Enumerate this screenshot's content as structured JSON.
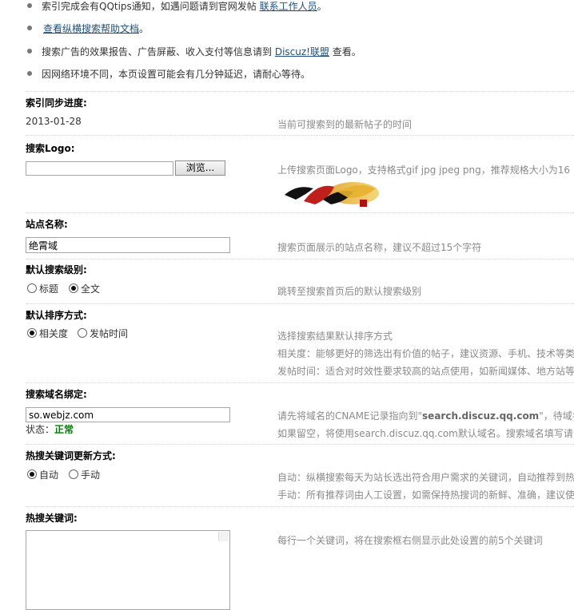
{
  "tips": {
    "item1": {
      "text": "索引完成会有QQtips通知，如遇问题请到官网发帖 ",
      "link": "联系工作人员",
      "after": "。"
    },
    "item2": {
      "link": "查看纵横搜索帮助文档",
      "after": "。"
    },
    "item3": {
      "text": "搜索广告的效果报告、广告屏蔽、收入支付等信息请到 ",
      "link": "Discuz!联盟",
      "after": " 查看。"
    },
    "item4": {
      "text": "因网络环境不同，本页设置可能会有几分钟延迟，请耐心等待。"
    }
  },
  "index_progress": {
    "label": "索引同步进度:",
    "value": "2013-01-28",
    "hint": "当前可搜索到的最新帖子的时间"
  },
  "search_logo": {
    "label": "搜索Logo:",
    "file_value": "",
    "browse_label": "浏览...",
    "hint": "上传搜索页面Logo，支持格式gif jpg jpeg png，推荐规格大小为16"
  },
  "site_name": {
    "label": "站点名称:",
    "value": "绝霄域",
    "hint": "搜索页面展示的站点名称，建议不超过15个字符"
  },
  "default_level": {
    "label": "默认搜索级别:",
    "options": [
      "标题",
      "全文"
    ],
    "selected": "全文",
    "hint": "跳转至搜索首页后的默认搜索级别"
  },
  "default_sort": {
    "label": "默认排序方式:",
    "options": [
      "相关度",
      "发帖时间"
    ],
    "selected": "相关度",
    "hint1": "选择搜索结果默认排序方式",
    "hint2": "相关度：能够更好的筛选出有价值的帖子，建议资源、手机、技术等类",
    "hint3": "发帖时间：适合对时效性要求较高的站点使用，如新闻媒体、地方站等"
  },
  "domain_bind": {
    "label": "搜索域名绑定:",
    "value": "so.webjz.com",
    "status_label": "状态：",
    "status_value": "正常",
    "hint1_pre": "请先将域名的CNAME记录指向到\"",
    "hint1_bold": "search.discuz.qq.com",
    "hint1_post": "\"，待域名",
    "hint2": "如果留空，将使用search.discuz.qq.com默认域名。搜索域名填写请",
    "colors": {
      "status": "#008000"
    }
  },
  "hot_update": {
    "label": "热搜关键词更新方式:",
    "options": [
      "自动",
      "手动"
    ],
    "selected": "自动",
    "hint1": "自动：纵横搜索每天为站长选出符合用户需求的关键词，自动推荐到热",
    "hint2": "手动：所有推荐词由人工设置，如需保持热搜词的新鲜、准确，建议使"
  },
  "hot_keywords": {
    "label": "热搜关键词:",
    "value": "",
    "hint": "每行一个关键词，将在搜索框右侧显示此处设置的前5个关键词"
  },
  "colors": {
    "link": "#1d4f7e",
    "hint": "#8a8a8a",
    "label": "#000000"
  }
}
